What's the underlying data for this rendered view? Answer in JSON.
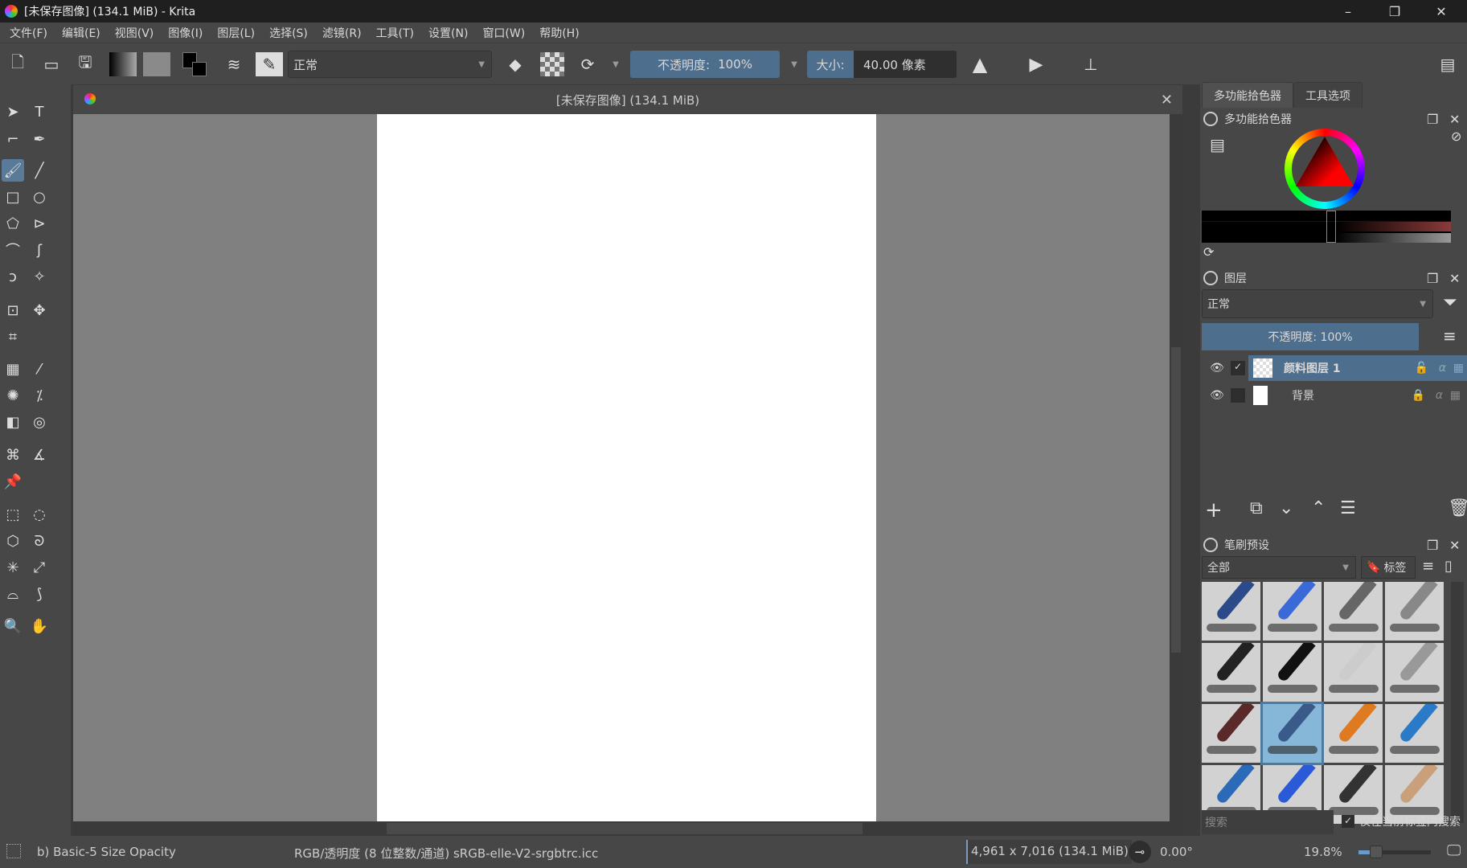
{
  "window": {
    "title": "[未保存图像]  (134.1 MiB)  - Krita",
    "minimize": "–",
    "restore": "❐",
    "close": "✕"
  },
  "menu": [
    "文件(F)",
    "编辑(E)",
    "视图(V)",
    "图像(I)",
    "图层(L)",
    "选择(S)",
    "滤镜(R)",
    "工具(T)",
    "设置(N)",
    "窗口(W)",
    "帮助(H)"
  ],
  "toolbar": {
    "blend_mode": "正常",
    "opacity_label": "不透明度:",
    "opacity_value": "100%",
    "size_label": "大小:",
    "size_value": "40.00 像素"
  },
  "document": {
    "tab_title": "[未保存图像]  (134.1 MiB)",
    "close": "✕"
  },
  "dock": {
    "tabs": [
      "多功能拾色器",
      "工具选项"
    ],
    "color_panel": {
      "title": "多功能拾色器",
      "selected_hue": "#ff0000"
    },
    "layers_panel": {
      "title": "图层",
      "blend_mode": "正常",
      "opacity": "不透明度:  100%",
      "layers": [
        {
          "name": "颜料图层 1",
          "visible": true,
          "selected": true,
          "locked": false
        },
        {
          "name": "背景",
          "visible": true,
          "selected": false,
          "locked": true
        }
      ]
    },
    "brush_panel": {
      "title": "笔刷预设",
      "filter": "全部",
      "tag_button": "标签",
      "search_placeholder": "搜索",
      "search_in_tag": "仅在当前标签内搜索",
      "selected_index": 9
    }
  },
  "status": {
    "brush": "b) Basic-5 Size Opacity",
    "color_space": "RGB/透明度 (8 位整数/通道)  sRGB-elle-V2-srgbtrc.icc",
    "dimensions": "4,961 x 7,016 (134.1 MiB)",
    "rotation": "0.00°",
    "zoom": "19.8%",
    "zoom_fraction": 0.2
  }
}
